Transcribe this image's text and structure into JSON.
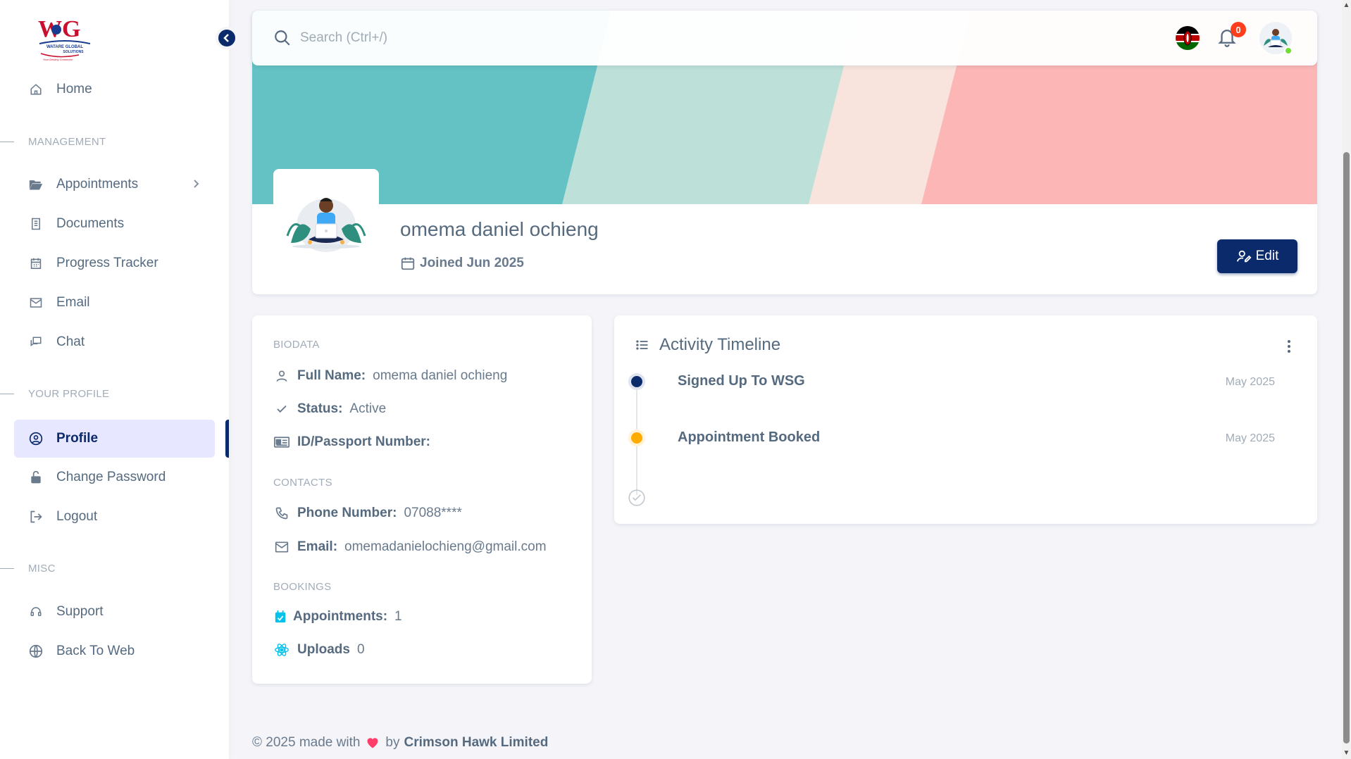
{
  "brand": {
    "logo_text": "WG",
    "logo_subtitle": "WATARE GLOBAL SOLUTIONS",
    "logo_tagline": "Your Destiny Connector"
  },
  "sidebar": {
    "home": "Home",
    "management_header": "MANAGEMENT",
    "appointments": "Appointments",
    "documents": "Documents",
    "progress_tracker": "Progress Tracker",
    "email": "Email",
    "chat": "Chat",
    "profile_header": "YOUR PROFILE",
    "profile": "Profile",
    "change_password": "Change Password",
    "logout": "Logout",
    "misc_header": "MISC",
    "support": "Support",
    "back_to_web": "Back To Web"
  },
  "navbar": {
    "search_placeholder": "Search (Ctrl+/)",
    "notification_count": "0"
  },
  "profile": {
    "name": "omema daniel ochieng",
    "joined": "Joined Jun 2025",
    "edit_label": "Edit"
  },
  "biodata": {
    "header": "BIODATA",
    "full_name_label": "Full Name:",
    "full_name": "omema daniel ochieng",
    "status_label": "Status:",
    "status": "Active",
    "id_label": "ID/Passport Number:",
    "id_value": "",
    "contacts_header": "CONTACTS",
    "phone_label": "Phone Number:",
    "phone": "07088****",
    "email_label": "Email:",
    "email": "omemadanielochieng@gmail.com",
    "bookings_header": "BOOKINGS",
    "appointments_label": "Appointments:",
    "appointments": "1",
    "uploads_label": "Uploads",
    "uploads": "0"
  },
  "timeline": {
    "title": "Activity Timeline",
    "events": [
      {
        "label": "Signed Up To WSG",
        "date": "May 2025",
        "color": "#0b2a6b"
      },
      {
        "label": "Appointment Booked",
        "date": "May 2025",
        "color": "#ffab00"
      }
    ]
  },
  "footer": {
    "prefix": "© 2025 made with",
    "by": "by",
    "company": "Crimson Hawk Limited"
  },
  "colors": {
    "primary": "#0b2a6b",
    "banner_teal": "#64c1c4",
    "banner_mint": "#bde0d8",
    "banner_peach": "#f8e4dc",
    "banner_pink": "#fcb6b5",
    "badge_red": "#ff3e1d"
  }
}
